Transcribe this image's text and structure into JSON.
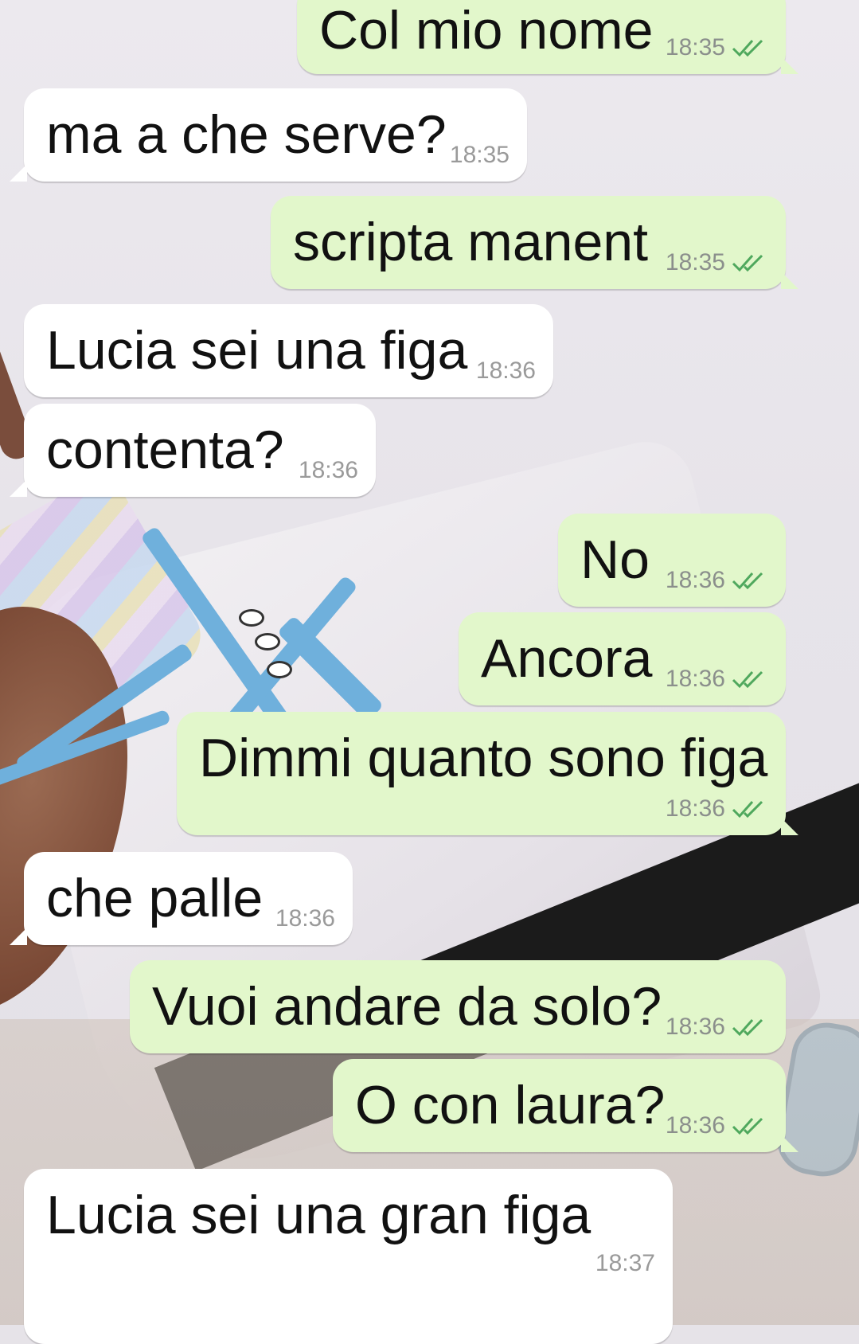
{
  "colors": {
    "incoming_bubble": "#ffffff",
    "outgoing_bubble": "#e2f7cb",
    "read_ticks": "#4fa85d",
    "timestamp": "#8b8f8c"
  },
  "messages": [
    {
      "direction": "out",
      "text": "Col mio nome",
      "time": "18:35",
      "status_icon": "double-check-read-icon"
    },
    {
      "direction": "in",
      "text": "ma a che serve?",
      "time": "18:35"
    },
    {
      "direction": "out",
      "text": "scripta manent",
      "time": "18:35",
      "status_icon": "double-check-read-icon"
    },
    {
      "direction": "in",
      "text": "Lucia sei una figa",
      "time": "18:36"
    },
    {
      "direction": "in",
      "text": "contenta?",
      "time": "18:36"
    },
    {
      "direction": "out",
      "text": "No",
      "time": "18:36",
      "status_icon": "double-check-read-icon"
    },
    {
      "direction": "out",
      "text": "Ancora",
      "time": "18:36",
      "status_icon": "double-check-read-icon"
    },
    {
      "direction": "out",
      "text": "Dimmi quanto sono figa",
      "time": "18:36",
      "status_icon": "double-check-read-icon"
    },
    {
      "direction": "in",
      "text": "che palle",
      "time": "18:36"
    },
    {
      "direction": "out",
      "text": "Vuoi andare da solo?",
      "time": "18:36",
      "status_icon": "double-check-read-icon"
    },
    {
      "direction": "out",
      "text": "O con laura?",
      "time": "18:36",
      "status_icon": "double-check-read-icon"
    },
    {
      "direction": "in",
      "text": "Lucia sei una gran figa",
      "time": "18:37"
    }
  ]
}
